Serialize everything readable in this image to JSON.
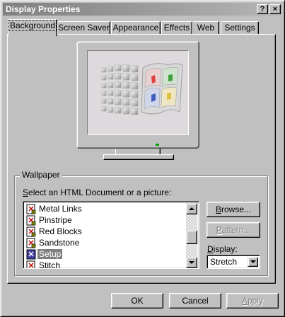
{
  "window": {
    "title": "Display Properties",
    "help_label": "?",
    "close_label": "×"
  },
  "tabs": [
    {
      "label": "Background",
      "active": true
    },
    {
      "label": "Screen Saver",
      "active": false
    },
    {
      "label": "Appearance",
      "active": false
    },
    {
      "label": "Effects",
      "active": false
    },
    {
      "label": "Web",
      "active": false
    },
    {
      "label": "Settings",
      "active": false
    }
  ],
  "wallpaper": {
    "group_label": "Wallpaper",
    "select_label_prefix": "S",
    "select_label_rest": "elect an HTML Document or a picture:",
    "items": [
      {
        "label": "Metal Links",
        "selected": false
      },
      {
        "label": "Pinstripe",
        "selected": false
      },
      {
        "label": "Red Blocks",
        "selected": false
      },
      {
        "label": "Sandstone",
        "selected": false
      },
      {
        "label": "Setup",
        "selected": true
      },
      {
        "label": "Stitch",
        "selected": false
      }
    ],
    "browse_prefix": "B",
    "browse_rest": "rowse...",
    "pattern_prefix": "P",
    "pattern_rest": "attern...",
    "display_prefix": "D",
    "display_rest": "isplay:",
    "display_value": "Stretch"
  },
  "footer": {
    "ok": "OK",
    "cancel": "Cancel",
    "apply_prefix": "A",
    "apply_rest": "pply"
  },
  "colors": {
    "face": "#c0c0c0",
    "title_start": "#808080",
    "title_end": "#b5b5b5",
    "selection": "#808080"
  }
}
